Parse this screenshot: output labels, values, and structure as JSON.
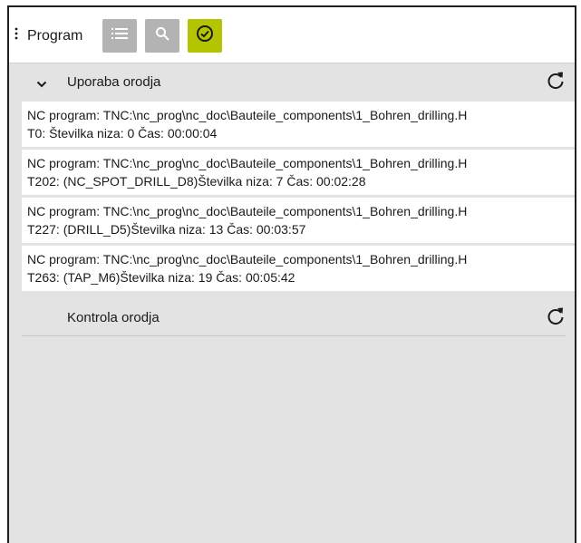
{
  "toolbar": {
    "title": "Program",
    "buttons": [
      {
        "icon": "list-icon"
      },
      {
        "icon": "search-icon"
      },
      {
        "icon": "check-circle-icon",
        "active": true
      }
    ]
  },
  "sections": [
    {
      "title": "Uporaba orodja",
      "expanded": true,
      "rows": [
        {
          "line1": "NC program: TNC:\\nc_prog\\nc_doc\\Bauteile_components\\1_Bohren_drilling.H",
          "line2": "T0: Številka niza: 0 Čas: 00:00:04"
        },
        {
          "line1": "NC program: TNC:\\nc_prog\\nc_doc\\Bauteile_components\\1_Bohren_drilling.H",
          "line2": "T202: (NC_SPOT_DRILL_D8)Številka niza: 7 Čas: 00:02:28"
        },
        {
          "line1": "NC program: TNC:\\nc_prog\\nc_doc\\Bauteile_components\\1_Bohren_drilling.H",
          "line2": "T227: (DRILL_D5)Številka niza: 13 Čas: 00:03:57"
        },
        {
          "line1": "NC program: TNC:\\nc_prog\\nc_doc\\Bauteile_components\\1_Bohren_drilling.H",
          "line2": "T263: (TAP_M6)Številka niza: 19 Čas: 00:05:42"
        }
      ]
    },
    {
      "title": "Kontrola orodja",
      "expanded": false,
      "rows": []
    }
  ],
  "colors": {
    "active_button": "#b5c400",
    "inactive_button": "#b3b3b3",
    "panel_background": "#e3e3e3"
  }
}
